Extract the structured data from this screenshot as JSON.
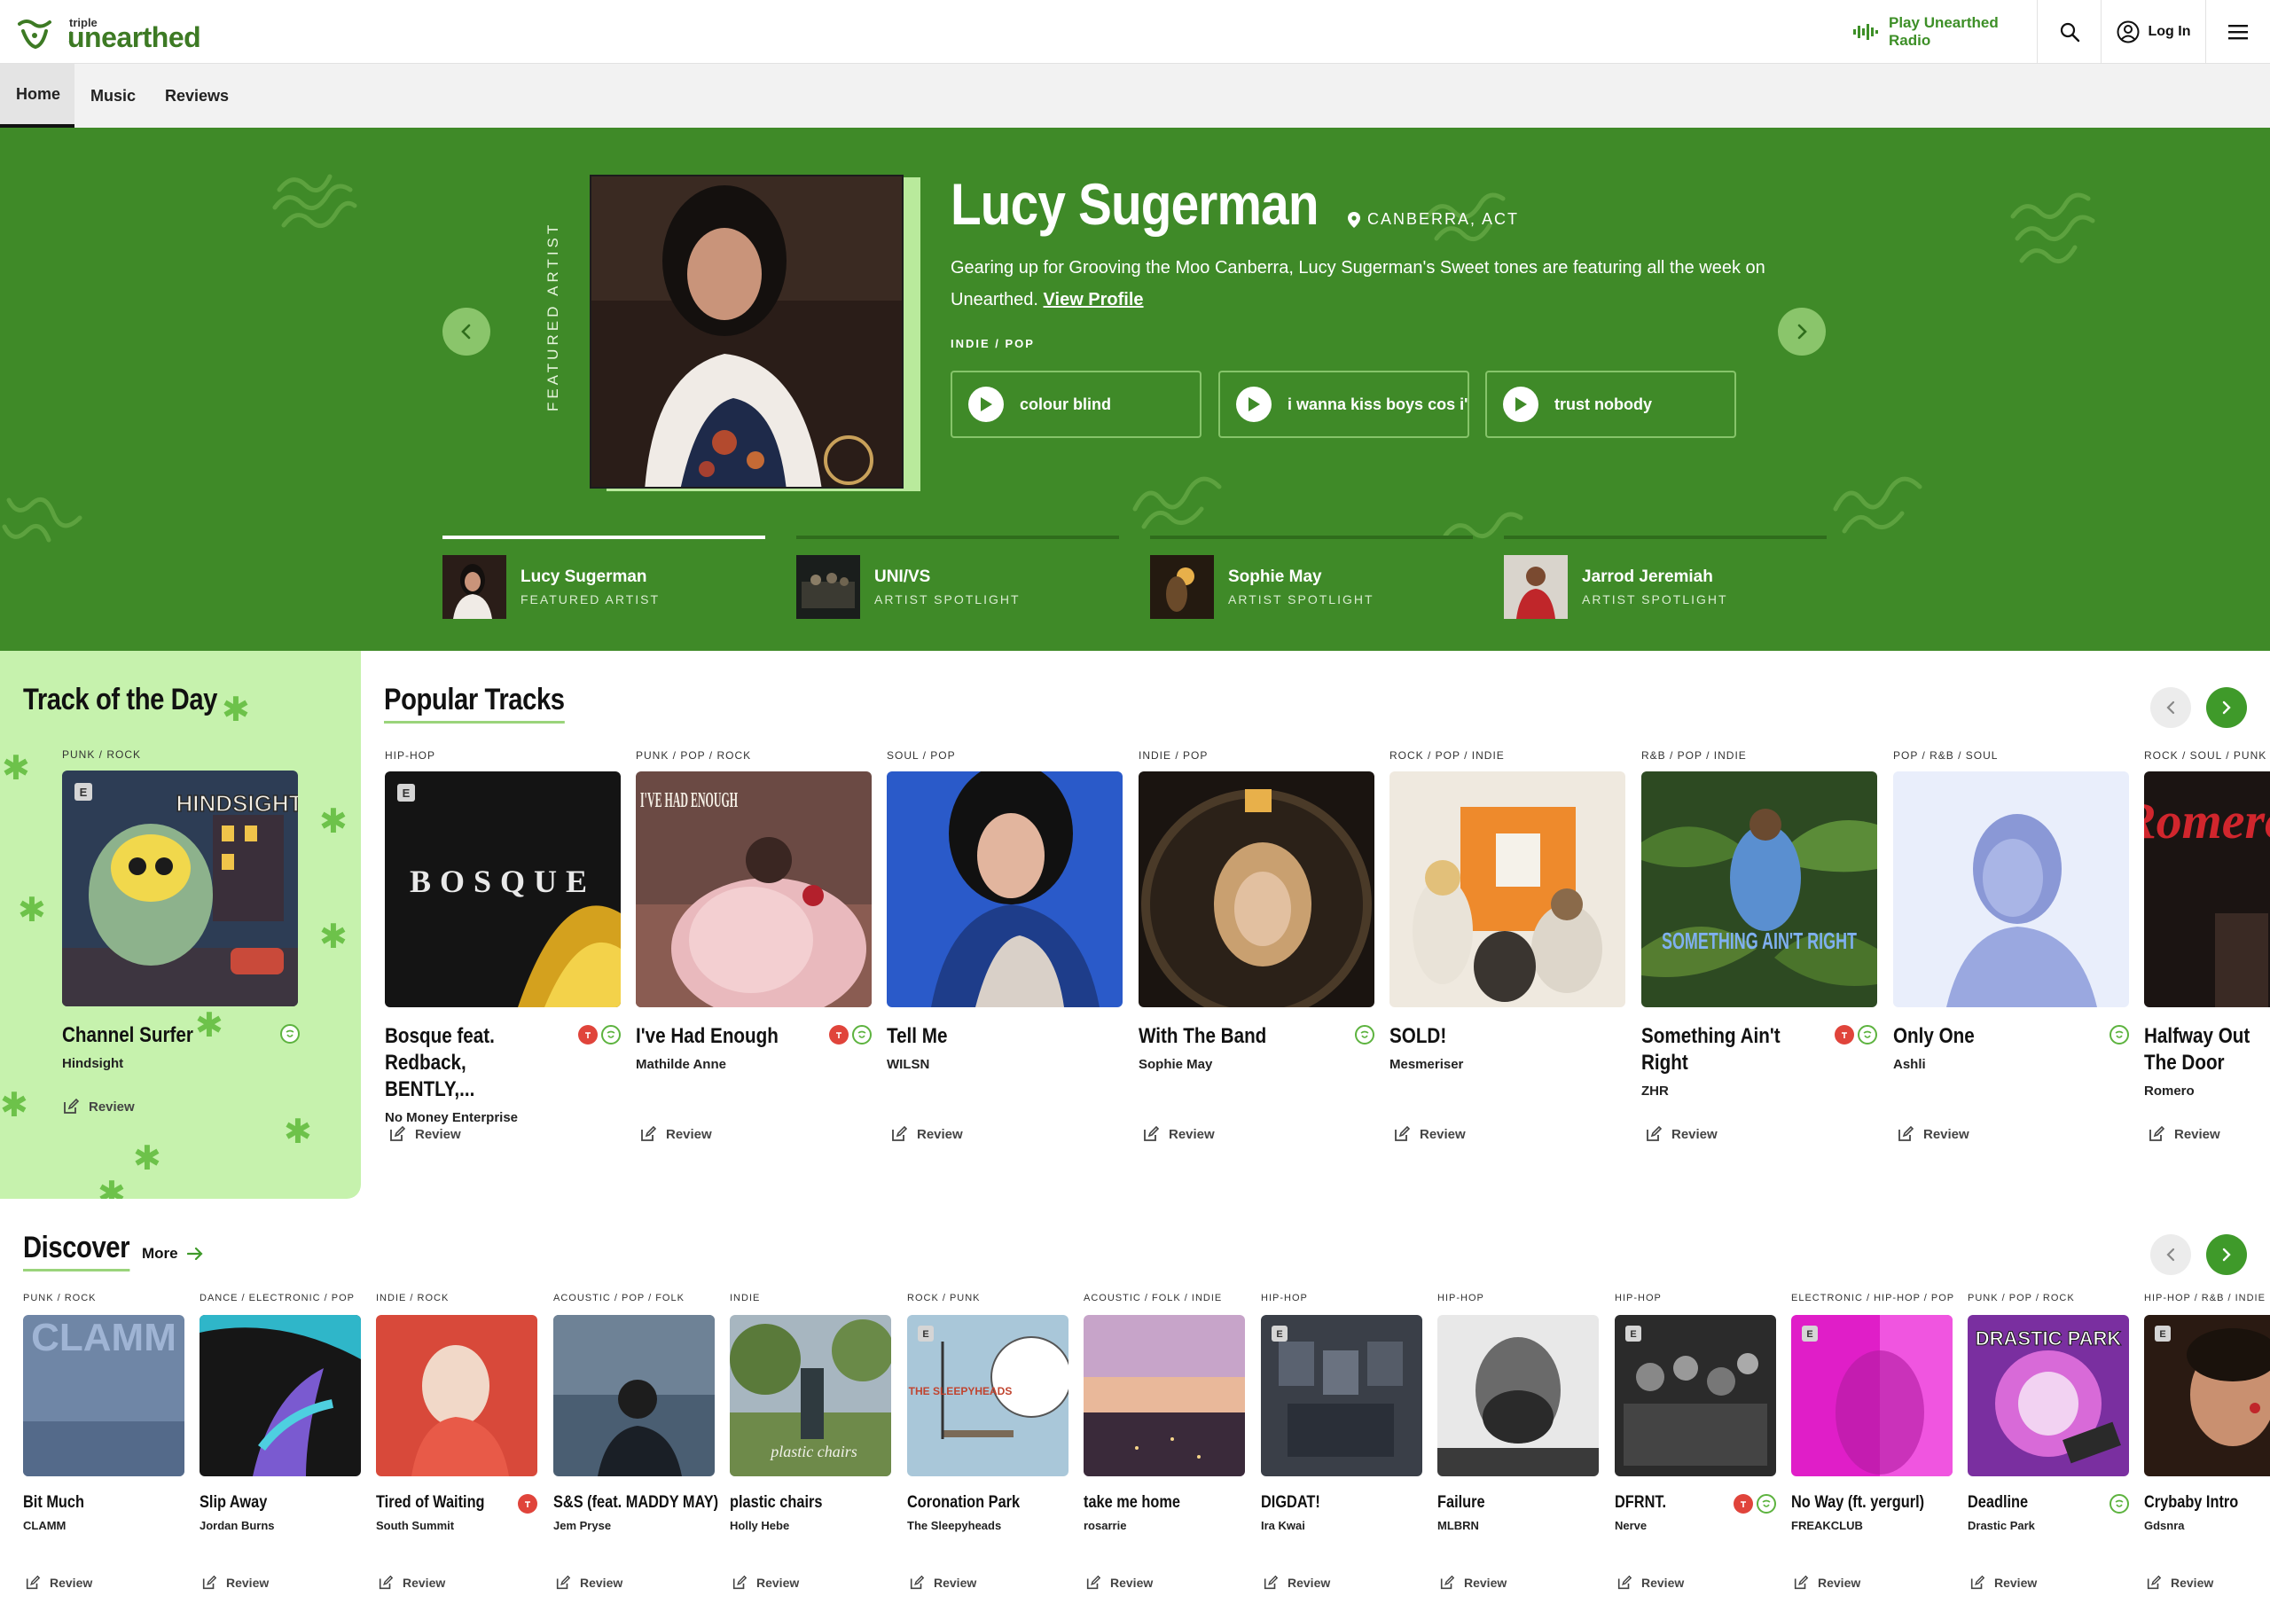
{
  "header": {
    "logo_small": "triple j",
    "logo_text": "unearthed",
    "radio_label": "Play Unearthed Radio",
    "login_label": "Log In"
  },
  "nav": {
    "tabs": [
      {
        "label": "Home"
      },
      {
        "label": "Music"
      },
      {
        "label": "Reviews"
      }
    ]
  },
  "hero": {
    "side_label": "FEATURED ARTIST",
    "name": "Lucy Sugerman",
    "location": "CANBERRA, ACT",
    "description": "Gearing up for Grooving the Moo Canberra, Lucy Sugerman's Sweet tones are featuring all the week on Unearthed.",
    "profile_link": "View Profile",
    "genre": "INDIE / POP",
    "tracks": [
      {
        "title": "colour blind"
      },
      {
        "title": "i wanna kiss boys cos i'm I"
      },
      {
        "title": "trust nobody"
      }
    ],
    "slide_progress": 1,
    "spotlights": [
      {
        "name": "Lucy Sugerman",
        "sub": "FEATURED ARTIST"
      },
      {
        "name": "UNI/VS",
        "sub": "ARTIST SPOTLIGHT"
      },
      {
        "name": "Sophie May",
        "sub": "ARTIST SPOTLIGHT"
      },
      {
        "name": "Jarrod Jeremiah",
        "sub": "ARTIST SPOTLIGHT"
      }
    ]
  },
  "totd": {
    "title": "Track of the Day",
    "genre": "PUNK / ROCK",
    "art_text": "HINDSIGHT",
    "track": "Channel Surfer",
    "artist": "Hindsight",
    "review": "Review"
  },
  "popular": {
    "title": "Popular Tracks",
    "tracks": [
      {
        "genre": "HIP-HOP",
        "title": "Bosque feat. Redback, BENTLY,...",
        "artist": "No Money Enterprise",
        "review": "Review",
        "art_text": "BOSQUE"
      },
      {
        "genre": "PUNK / POP / ROCK",
        "title": "I've Had Enough",
        "artist": "Mathilde Anne",
        "review": "Review",
        "art_text": "I'VE HAD ENOUGH"
      },
      {
        "genre": "SOUL / POP",
        "title": "Tell Me",
        "artist": "WILSN",
        "review": "Review",
        "art_text": ""
      },
      {
        "genre": "INDIE / POP",
        "title": "With The Band",
        "artist": "Sophie May",
        "review": "Review",
        "art_text": ""
      },
      {
        "genre": "ROCK / POP / INDIE",
        "title": "SOLD!",
        "artist": "Mesmeriser",
        "review": "Review",
        "art_text": ""
      },
      {
        "genre": "R&B / POP / INDIE",
        "title": "Something Ain't Right",
        "artist": "ZHR",
        "review": "Review",
        "art_text": "SOMETHING AIN'T RIGHT"
      },
      {
        "genre": "POP / R&B / SOUL",
        "title": "Only One",
        "artist": "Ashli",
        "review": "Review",
        "art_text": ""
      },
      {
        "genre": "ROCK / SOUL / PUNK",
        "title": "Halfway Out The Door",
        "artist": "Romero",
        "review": "Review",
        "art_text": "Romero"
      }
    ]
  },
  "discover": {
    "title": "Discover",
    "more": "More",
    "tracks": [
      {
        "genre": "PUNK / ROCK",
        "title": "Bit Much",
        "artist": "CLAMM",
        "review": "Review",
        "art_text": "CLAMM"
      },
      {
        "genre": "DANCE / ELECTRONIC / POP",
        "title": "Slip Away",
        "artist": "Jordan Burns",
        "review": "Review",
        "art_text": ""
      },
      {
        "genre": "INDIE / ROCK",
        "title": "Tired of Waiting",
        "artist": "South Summit",
        "review": "Review",
        "art_text": ""
      },
      {
        "genre": "ACOUSTIC / POP / FOLK",
        "title": "S&S (feat. MADDY MAY)",
        "artist": "Jem Pryse",
        "review": "Review",
        "art_text": ""
      },
      {
        "genre": "INDIE",
        "title": "plastic chairs",
        "artist": "Holly Hebe",
        "review": "Review",
        "art_text": "plastic chairs"
      },
      {
        "genre": "ROCK / PUNK",
        "title": "Coronation Park",
        "artist": "The Sleepyheads",
        "review": "Review",
        "art_text": "THE SLEEPYHEADS"
      },
      {
        "genre": "ACOUSTIC / FOLK / INDIE",
        "title": "take me home",
        "artist": "rosarrie",
        "review": "Review",
        "art_text": ""
      },
      {
        "genre": "HIP-HOP",
        "title": "DIGDAT!",
        "artist": "Ira Kwai",
        "review": "Review",
        "art_text": ""
      },
      {
        "genre": "HIP-HOP",
        "title": "Failure",
        "artist": "MLBRN",
        "review": "Review",
        "art_text": ""
      },
      {
        "genre": "HIP-HOP",
        "title": "DFRNT.",
        "artist": "Nerve",
        "review": "Review",
        "art_text": ""
      },
      {
        "genre": "ELECTRONIC / HIP-HOP / POP",
        "title": "No Way (ft. yergurl)",
        "artist": "FREAKCLUB",
        "review": "Review",
        "art_text": ""
      },
      {
        "genre": "PUNK / POP / ROCK",
        "title": "Deadline",
        "artist": "Drastic Park",
        "review": "Review",
        "art_text": "DRASTIC PARK"
      },
      {
        "genre": "HIP-HOP / R&B / INDIE",
        "title": "Crybaby Intro",
        "artist": "Gdsnra",
        "review": "Review",
        "art_text": ""
      }
    ]
  },
  "colors": {
    "brand_green": "#3f8a28",
    "light_green": "#c6f2ad",
    "accent_green": "#3f9a2a",
    "badge_red": "#e0443b"
  },
  "icons": [
    "logo-icon",
    "radio-wave-icon",
    "search-icon",
    "user-icon",
    "menu-icon",
    "chevron-left-icon",
    "chevron-right-icon",
    "location-pin-icon",
    "play-icon",
    "edit-icon",
    "arrow-right-icon",
    "unearthed-badge-icon",
    "triple-j-badge-icon"
  ]
}
